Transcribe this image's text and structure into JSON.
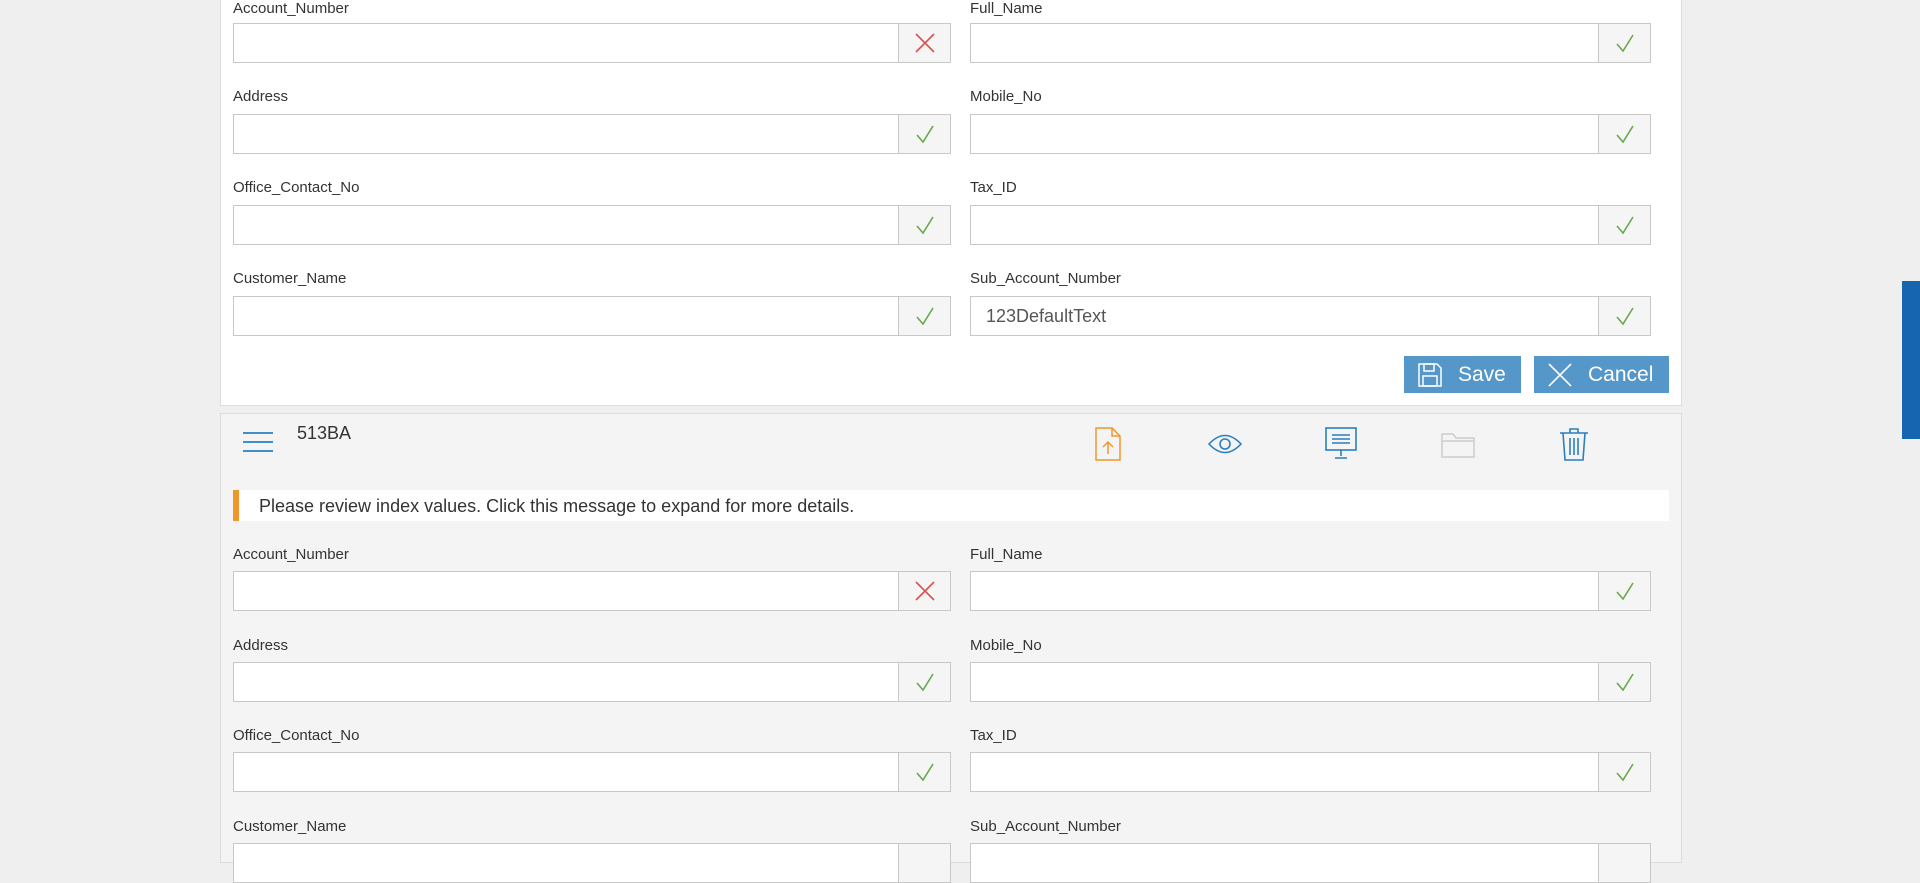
{
  "form_top": {
    "fields": [
      {
        "label": "Account_Number",
        "value": "",
        "status": "error"
      },
      {
        "label": "Full_Name",
        "value": "",
        "status": "valid"
      },
      {
        "label": "Address",
        "value": "",
        "status": "valid"
      },
      {
        "label": "Mobile_No",
        "value": "",
        "status": "valid"
      },
      {
        "label": "Office_Contact_No",
        "value": "",
        "status": "valid"
      },
      {
        "label": "Tax_ID",
        "value": "",
        "status": "valid"
      },
      {
        "label": "Customer_Name",
        "value": "",
        "status": "valid"
      },
      {
        "label": "Sub_Account_Number",
        "value": "123DefaultText",
        "status": "valid"
      }
    ],
    "save_label": "Save",
    "cancel_label": "Cancel"
  },
  "document": {
    "id": "513BA",
    "toolbar": [
      "upload-file-icon",
      "eye-icon",
      "monitor-icon",
      "folder-icon",
      "trash-icon"
    ],
    "notice": "Please review index values. Click this message to expand for more details.",
    "fields": [
      {
        "label": "Account_Number",
        "value": "",
        "status": "error"
      },
      {
        "label": "Full_Name",
        "value": "",
        "status": "valid"
      },
      {
        "label": "Address",
        "value": "",
        "status": "valid"
      },
      {
        "label": "Mobile_No",
        "value": "",
        "status": "valid"
      },
      {
        "label": "Office_Contact_No",
        "value": "",
        "status": "valid"
      },
      {
        "label": "Tax_ID",
        "value": "",
        "status": "valid"
      },
      {
        "label": "Customer_Name",
        "value": "",
        "status": "valid"
      },
      {
        "label": "Sub_Account_Number",
        "value": "",
        "status": "valid"
      }
    ]
  },
  "colors": {
    "accent": "#5597c8",
    "scrollbar": "#1565b0",
    "error": "#d9534f",
    "valid": "#6aa84f",
    "notice_bar": "#f0962a",
    "toolbar_blue": "#2a7fc0",
    "toolbar_orange": "#f0962a",
    "toolbar_disabled": "#cccccc"
  }
}
